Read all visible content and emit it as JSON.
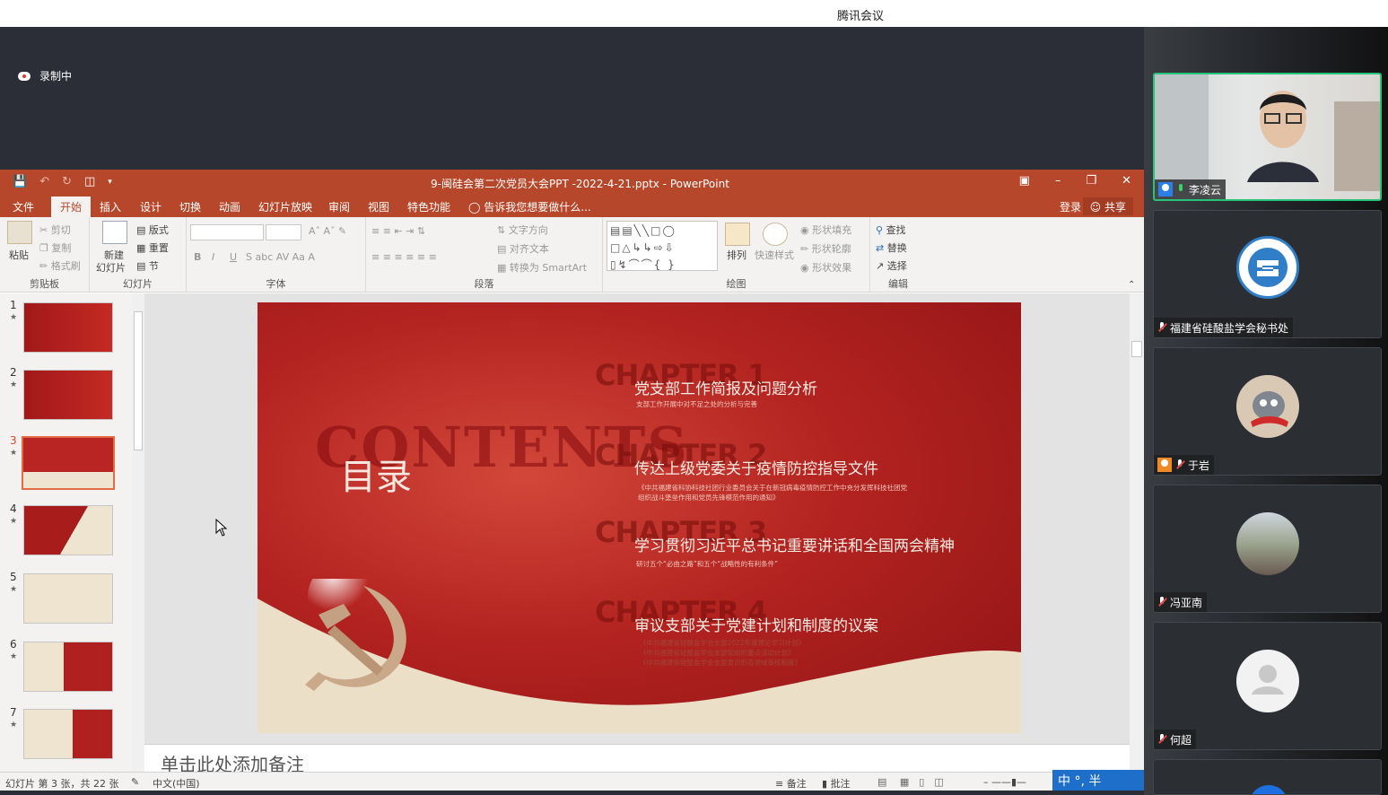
{
  "app_title": "腾讯会议",
  "recording_label": "录制中",
  "ppt": {
    "window_title": "9-闽硅会第二次党员大会PPT -2022-4-21.pptx - PowerPoint",
    "tabs": [
      "文件",
      "开始",
      "插入",
      "设计",
      "切换",
      "动画",
      "幻灯片放映",
      "审阅",
      "视图",
      "特色功能"
    ],
    "tell_me": "告诉我您想要做什么...",
    "login": "登录",
    "share": "共享",
    "ribbon": {
      "clipboard": {
        "paste": "粘贴",
        "cut": "剪切",
        "copy": "复制",
        "format_painter": "格式刷",
        "label": "剪贴板"
      },
      "slides": {
        "new_slide": "新建",
        "new_slide2": "幻灯片",
        "layout": "版式",
        "reset": "重置",
        "section": "节",
        "label": "幻灯片"
      },
      "font": {
        "label": "字体"
      },
      "paragraph": {
        "text_direction": "文字方向",
        "align_text": "对齐文本",
        "smartart": "转换为 SmartArt",
        "label": "段落"
      },
      "drawing": {
        "arrange": "排列",
        "quick_styles": "快速样式",
        "shape_fill": "形状填充",
        "shape_outline": "形状轮廓",
        "shape_effects": "形状效果",
        "label": "绘图"
      },
      "editing": {
        "find": "查找",
        "replace": "替换",
        "select": "选择",
        "label": "编辑"
      }
    },
    "slide_numbers": [
      "1",
      "2",
      "3",
      "4",
      "5",
      "6",
      "7"
    ],
    "slide": {
      "contents": "CONTENTS",
      "title": "目录",
      "chapters": [
        {
          "tag": "CHAPTER 1",
          "head": "党支部工作简报及问题分析",
          "sub": [
            "支部工作开展中对不足之处的分析与完善"
          ]
        },
        {
          "tag": "CHAPTER 2",
          "head": "传达上级党委关于疫情防控指导文件",
          "sub": [
            "《中共福建省科协科技社团行业委员会关于在新冠病毒疫情防控工作中充分发挥科技社团党",
            "组织战斗堡垒作用和党员先锋模范作用的通知》"
          ]
        },
        {
          "tag": "CHAPTER 3",
          "head": "学习贯彻习近平总书记重要讲话和全国两会精神",
          "sub": [
            "研讨五个“必由之路”和五个“战略性的有利条件”"
          ]
        },
        {
          "tag": "CHAPTER 4",
          "head": "审议支部关于党建计划和制度的议案",
          "sub": [
            "《中共福建省硅酸盐学会支部2022年度理论学习计划》",
            "《中共福建省硅酸盐学会支部党组织重点活动计划》",
            "《中共福建省硅酸盐学会支部意识形态领域审核制度》"
          ]
        }
      ]
    },
    "notes_placeholder": "单击此处添加备注",
    "status": {
      "slide_info": "幻灯片 第 3 张，共 22 张",
      "language": "中文(中国)",
      "notes": "备注",
      "comments": "批注"
    },
    "ime": "中 °, 半"
  },
  "participants": [
    {
      "name": "李凌云",
      "type": "video"
    },
    {
      "name": "福建省硅酸盐学会秘书处",
      "type": "logo"
    },
    {
      "name": "于岩",
      "type": "cartoon"
    },
    {
      "name": "冯亚南",
      "type": "photo"
    },
    {
      "name": "何超",
      "type": "default"
    }
  ]
}
